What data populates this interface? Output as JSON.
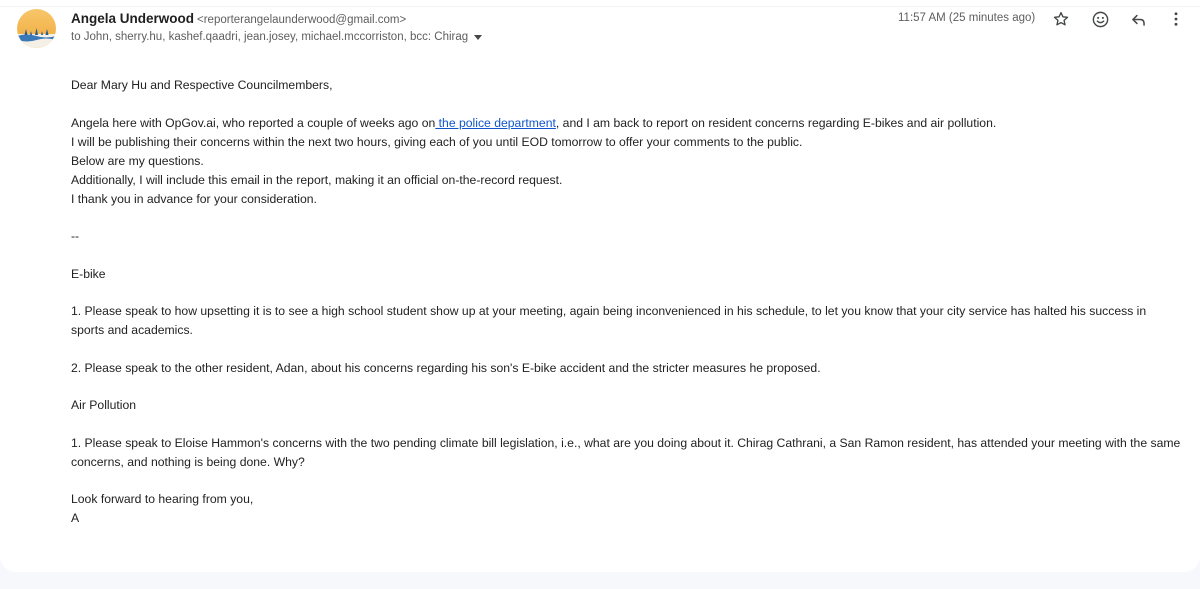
{
  "sender": {
    "name": "Angela Underwood",
    "email": "<reporterangelaunderwood@gmail.com>"
  },
  "recipients": "to John, sherry.hu, kashef.qaadri, jean.josey, michael.mccorriston, bcc: Chirag",
  "timestamp": "11:57 AM (25 minutes ago)",
  "icons": {
    "star": "star-icon",
    "emoji": "emoji-icon",
    "reply": "reply-icon",
    "more": "more-vert-icon"
  },
  "colors": {
    "link": "#1155cc",
    "avatar_sky": "#f5b942",
    "avatar_water": "#3a78b8"
  },
  "body": {
    "greeting": "Dear Mary Hu and Respective Councilmembers,",
    "intro_before_link": "Angela here with OpGov.ai, who reported a couple of weeks ago on",
    "intro_link": " the police department",
    "intro_after_link": ", and I am back to report on resident concerns regarding E-bikes and air pollution.",
    "line2": "I will be publishing their concerns within the next two hours, giving each of you until EOD tomorrow to offer your comments to the public.",
    "line3": "Below are my questions.",
    "line4": "Additionally, I will include this email in the report, making it an official on-the-record request.",
    "line5": "I thank you in advance for your consideration.",
    "separator": "--",
    "section1_title": "E-bike",
    "ebike_q1": "1. Please speak to how upsetting it is to see a high school student show up at your meeting, again being inconvenienced in his schedule, to let you know that your city service has halted his success in sports and academics.",
    "ebike_q2": "2. Please speak to the other resident, Adan, about his concerns regarding his son's E-bike accident and the stricter measures he proposed.",
    "section2_title": "Air Pollution",
    "air_q1": "1. Please speak to Eloise Hammon's concerns with the two pending climate bill legislation, i.e., what are you doing about it. Chirag Cathrani, a San Ramon resident, has attended your meeting with the same concerns, and nothing is being done. Why?",
    "closing": "Look forward to hearing from you,",
    "signature": "A"
  }
}
